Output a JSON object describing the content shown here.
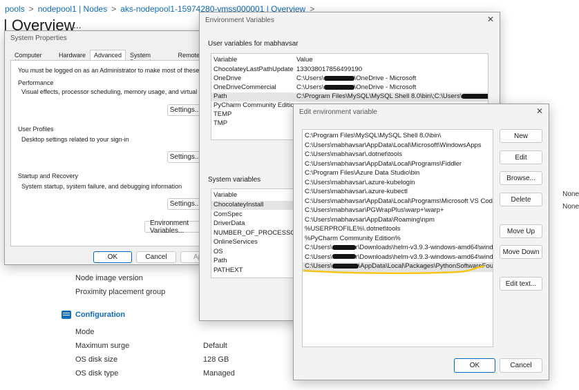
{
  "portal": {
    "breadcrumb": [
      "pools",
      "nodepool1 | Nodes",
      "aks-nodepool1-15974280-vmss000001 | Overview"
    ],
    "breadcrumb_sep": ">",
    "title": "| Overview",
    "more": "...",
    "properties": [
      {
        "label": "Node image version",
        "value": ""
      },
      {
        "label": "Proximity placement group",
        "value": ""
      }
    ],
    "configuration_heading": "Configuration",
    "configuration": [
      {
        "label": "Mode",
        "value": ""
      },
      {
        "label": "Maximum surge",
        "value": "Default"
      },
      {
        "label": "OS disk size",
        "value": "128 GB"
      },
      {
        "label": "OS disk type",
        "value": "Managed"
      }
    ],
    "edge_values": [
      "None",
      "None"
    ]
  },
  "system_properties": {
    "title": "System Properties",
    "tabs": [
      "Computer Name",
      "Hardware",
      "Advanced",
      "System Protection",
      "Remote"
    ],
    "active_tab": "Advanced",
    "admin_note": "You must be logged on as an Administrator to make most of these changes.",
    "performance": {
      "heading": "Performance",
      "desc": "Visual effects, processor scheduling, memory usage, and virtual memory",
      "button": "Settings..."
    },
    "user_profiles": {
      "heading": "User Profiles",
      "desc": "Desktop settings related to your sign-in",
      "button": "Settings..."
    },
    "startup": {
      "heading": "Startup and Recovery",
      "desc": "System startup, system failure, and debugging information",
      "button": "Settings..."
    },
    "env_button": "Environment Variables...",
    "ok": "OK",
    "cancel": "Cancel",
    "apply": "Ap"
  },
  "env_vars": {
    "title": "Environment Variables",
    "close": "✕",
    "user_label": "User variables for mabhavsar",
    "col_variable": "Variable",
    "col_value": "Value",
    "user_vars": [
      {
        "name": "ChocolateyLastPathUpdate",
        "value": "133038017856499190"
      },
      {
        "name": "OneDrive",
        "value": "C:\\Users\\",
        "value2": "\\OneDrive - Microsoft"
      },
      {
        "name": "OneDriveCommercial",
        "value": "C:\\Users\\",
        "value2": "\\OneDrive - Microsoft"
      },
      {
        "name": "Path",
        "value": "C:\\Program Files\\MySQL\\MySQL Shell 8.0\\bin\\;C:\\Users\\",
        "value2": ""
      },
      {
        "name": "PyCharm Community Edition",
        "value": ""
      },
      {
        "name": "TEMP",
        "value": ""
      },
      {
        "name": "TMP",
        "value": ""
      }
    ],
    "system_label": "System variables",
    "system_vars": [
      "ChocolateyInstall",
      "ComSpec",
      "DriverData",
      "NUMBER_OF_PROCESSORS",
      "OnlineServices",
      "OS",
      "Path",
      "PATHEXT"
    ]
  },
  "edit_env": {
    "title": "Edit environment variable",
    "close": "✕",
    "entries": [
      "C:\\Program Files\\MySQL\\MySQL Shell 8.0\\bin\\",
      "C:\\Users\\mabhavsar\\AppData\\Local\\Microsoft\\WindowsApps",
      "C:\\Users\\mabhavsar\\.dotnet\\tools",
      "C:\\Users\\mabhavsar\\AppData\\Local\\Programs\\Fiddler",
      "C:\\Program Files\\Azure Data Studio\\bin",
      "C:\\Users\\mabhavsar\\.azure-kubelogin",
      "C:\\Users\\mabhavsar\\.azure-kubectl",
      "C:\\Users\\mabhavsar\\AppData\\Local\\Programs\\Microsoft VS Code\\bin",
      "C:\\Users\\mabhavsar\\PGWrapPlus\\warp+\\warp+",
      "C:\\Users\\mabhavsar\\AppData\\Roaming\\npm",
      "%USERPROFILE%\\.dotnet\\tools",
      "%PyCharm Community Edition%"
    ],
    "redacted_entries": [
      {
        "prefix": "C:\\Users\\",
        "suffix": "r\\Downloads\\helm-v3.9.3-windows-amd64\\wind..."
      },
      {
        "prefix": "C:\\Users\\",
        "suffix": "r\\Downloads\\helm-v3.9.3-windows-amd64\\wind..."
      },
      {
        "prefix": "C:\\Users\\",
        "suffix": "\\AppData\\Local\\Packages\\PythonSoftwareFoun..."
      }
    ],
    "buttons": [
      "New",
      "Edit",
      "Browse...",
      "Delete",
      "Move Up",
      "Move Down",
      "Edit text..."
    ],
    "ok": "OK",
    "cancel": "Cancel",
    "underline_color": "#f5c518"
  }
}
